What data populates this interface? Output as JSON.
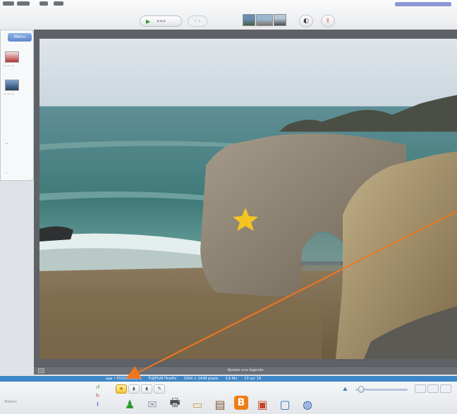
{
  "toolbar": {
    "slideshow_label": "»»»",
    "nav_label": "‹ ›",
    "thumbnails": [
      "thumb-1",
      "thumb-2",
      "thumb-3"
    ],
    "round_buttons": [
      {
        "name": "rotate-view-button",
        "glyph": "◐"
      },
      {
        "name": "upload-button",
        "glyph": "⇪"
      }
    ]
  },
  "sidebar": {
    "tab_label": "Menu"
  },
  "viewer": {
    "caption": "Ajouter une légende",
    "status_items": [
      "aaa • P1010555.JPG",
      "FUJIFILM FinePix",
      "3264 × 2448 pixels",
      "3,6 Mo",
      "13 sur 18"
    ]
  },
  "bottom": {
    "left_label": "Station",
    "edit_buttons": [
      "★",
      "◗",
      "◖",
      "✎"
    ],
    "actions": [
      {
        "name": "green-figure-icon",
        "glyph": "♟",
        "color": "#2e9a2e"
      },
      {
        "name": "envelope-icon",
        "glyph": "✉",
        "color": "#9aa4b0"
      },
      {
        "name": "printer-icon",
        "glyph": "🖶",
        "color": "#4b5058"
      },
      {
        "name": "folder-icon",
        "glyph": "▭",
        "color": "#c8a24a"
      },
      {
        "name": "film-icon",
        "glyph": "▤",
        "color": "#7d5a3c"
      },
      {
        "name": "blogger-icon",
        "glyph": "B",
        "color": "#ef7d16"
      },
      {
        "name": "photo-export-icon",
        "glyph": "▣",
        "color": "#c4452a"
      },
      {
        "name": "screen-icon",
        "glyph": "▢",
        "color": "#2f6fb3"
      },
      {
        "name": "globe-icon",
        "glyph": "◍",
        "color": "#3562b8"
      }
    ]
  },
  "colors": {
    "status_bar": "#3e86c6",
    "annotation_arrow": "#f0761e",
    "star": "#f4c520"
  }
}
